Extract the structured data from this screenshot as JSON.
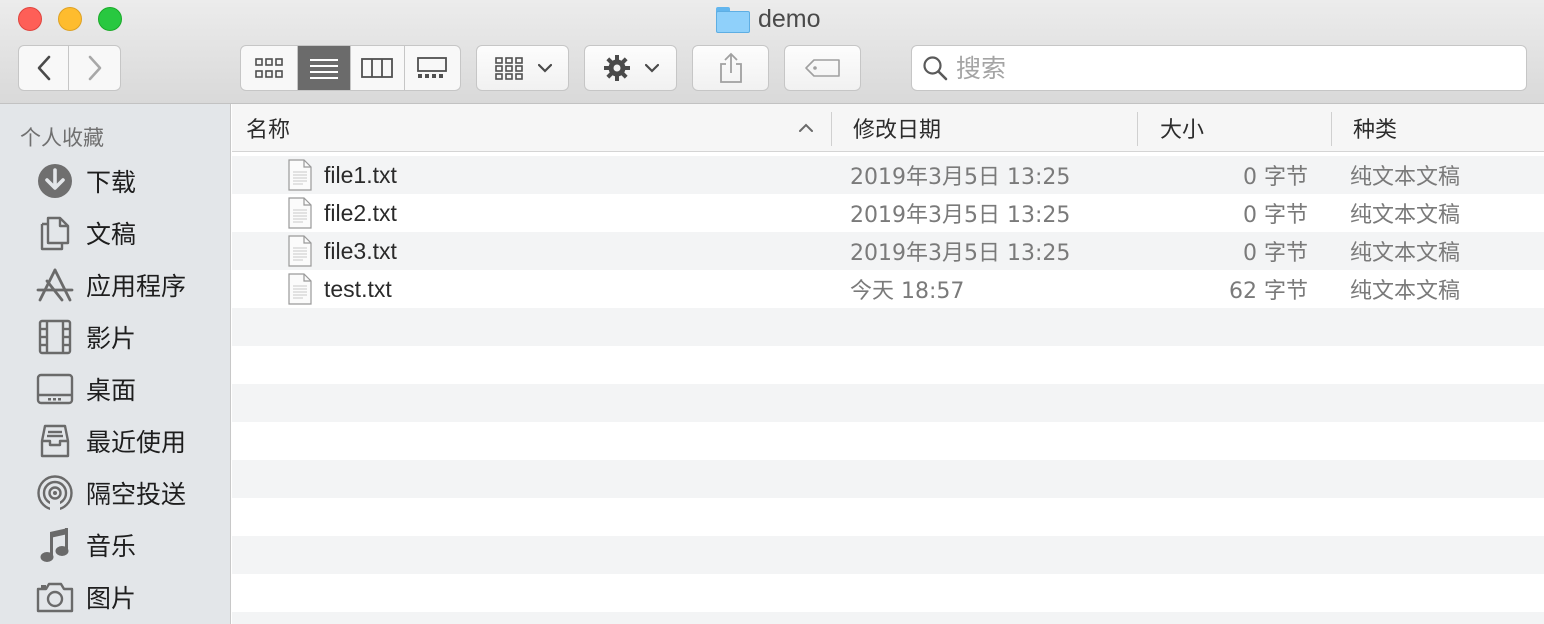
{
  "window": {
    "title": "demo"
  },
  "toolbar": {
    "search_placeholder": "搜索"
  },
  "sidebar": {
    "section_title": "个人收藏",
    "items": [
      {
        "label": "下载",
        "icon": "download-icon"
      },
      {
        "label": "文稿",
        "icon": "documents-icon"
      },
      {
        "label": "应用程序",
        "icon": "applications-icon"
      },
      {
        "label": "影片",
        "icon": "film-icon"
      },
      {
        "label": "桌面",
        "icon": "desktop-icon"
      },
      {
        "label": "最近使用",
        "icon": "recents-icon"
      },
      {
        "label": "隔空投送",
        "icon": "airdrop-icon"
      },
      {
        "label": "音乐",
        "icon": "music-icon"
      },
      {
        "label": "图片",
        "icon": "camera-icon"
      }
    ]
  },
  "columns": {
    "name": "名称",
    "modified": "修改日期",
    "size": "大小",
    "kind": "种类"
  },
  "files": [
    {
      "name": "file1.txt",
      "modified": "2019年3月5日 13:25",
      "size": "0 字节",
      "kind": "纯文本文稿"
    },
    {
      "name": "file2.txt",
      "modified": "2019年3月5日 13:25",
      "size": "0 字节",
      "kind": "纯文本文稿"
    },
    {
      "name": "file3.txt",
      "modified": "2019年3月5日 13:25",
      "size": "0 字节",
      "kind": "纯文本文稿"
    },
    {
      "name": "test.txt",
      "modified": "今天 18:57",
      "size": "62 字节",
      "kind": "纯文本文稿"
    }
  ],
  "colors": {
    "sidebar_bg": "#e3e6e9",
    "row_alt": "#f3f4f5",
    "active_segment": "#6b6b6b",
    "folder_blue": "#8fd0fa"
  }
}
